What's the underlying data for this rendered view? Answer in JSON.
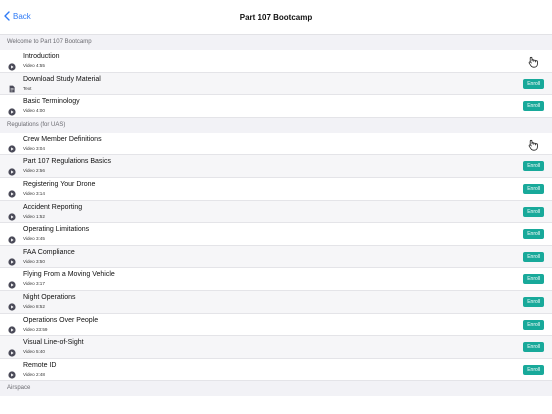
{
  "nav": {
    "back_label": "Back",
    "title": "Part 107 Bootcamp"
  },
  "sections": [
    {
      "title": "Welcome to Part 107 Bootcamp",
      "rows": [
        {
          "icon": "play-icon",
          "title": "Introduction",
          "subtitle": "Video 4:55",
          "action": "hand"
        },
        {
          "icon": "document-icon",
          "title": "Download Study Material",
          "subtitle": "Text",
          "action": "enroll"
        },
        {
          "icon": "play-icon",
          "title": "Basic Terminology",
          "subtitle": "Video 4:00",
          "action": "enroll"
        }
      ]
    },
    {
      "title": "Regulations (for UAS)",
      "rows": [
        {
          "icon": "play-icon",
          "title": "Crew Member Definitions",
          "subtitle": "Video 3:04",
          "action": "hand"
        },
        {
          "icon": "play-icon",
          "title": "Part 107 Regulations Basics",
          "subtitle": "Video 2:56",
          "action": "enroll"
        },
        {
          "icon": "play-icon",
          "title": "Registering Your Drone",
          "subtitle": "Video 3:14",
          "action": "enroll"
        },
        {
          "icon": "play-icon",
          "title": "Accident Reporting",
          "subtitle": "Video 1:52",
          "action": "enroll"
        },
        {
          "icon": "play-icon",
          "title": "Operating Limitations",
          "subtitle": "Video 3:45",
          "action": "enroll"
        },
        {
          "icon": "play-icon",
          "title": "FAA Compliance",
          "subtitle": "Video 3:50",
          "action": "enroll"
        },
        {
          "icon": "play-icon",
          "title": "Flying From a Moving Vehicle",
          "subtitle": "Video 3:17",
          "action": "enroll"
        },
        {
          "icon": "play-icon",
          "title": "Night Operations",
          "subtitle": "Video 8:52",
          "action": "enroll"
        },
        {
          "icon": "play-icon",
          "title": "Operations Over People",
          "subtitle": "Video 23:59",
          "action": "enroll"
        },
        {
          "icon": "play-icon",
          "title": "Visual Line-of-Sight",
          "subtitle": "Video 5:40",
          "action": "enroll"
        },
        {
          "icon": "play-icon",
          "title": "Remote ID",
          "subtitle": "Video 2:48",
          "action": "enroll"
        }
      ]
    },
    {
      "title": "Airspace",
      "rows": []
    }
  ],
  "enroll_label": "Enroll",
  "colors": {
    "accent": "#2f7bf6",
    "enroll": "#18a99a",
    "icon": "#4a4a58"
  }
}
